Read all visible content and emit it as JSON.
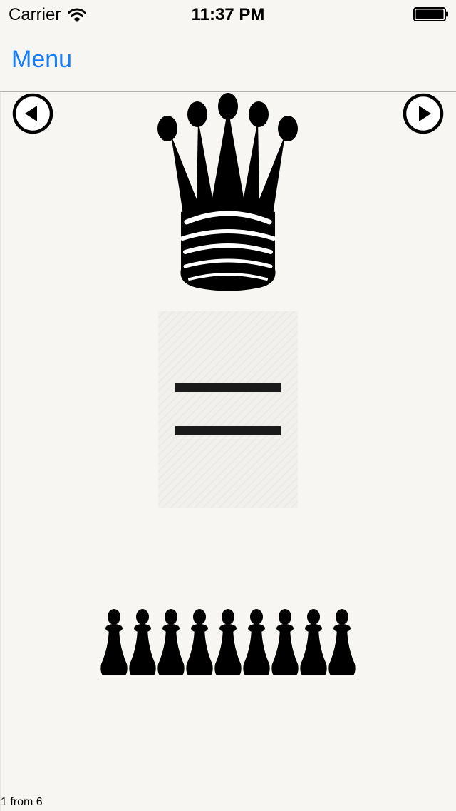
{
  "status_bar": {
    "carrier": "Carrier",
    "time": "11:37 PM",
    "wifi_icon": "wifi-icon",
    "battery_icon": "battery-full-icon"
  },
  "nav_bar": {
    "menu_label": "Menu"
  },
  "colors": {
    "accent": "#157efb",
    "background": "#f7f6f3",
    "icon": "#000000"
  },
  "main": {
    "prev_icon": "arrow-left-circle-icon",
    "next_icon": "arrow-right-circle-icon",
    "top_piece": "chess-queen-icon",
    "symbol": "equals-sign-icon",
    "bottom_piece": "chess-pawn-icon",
    "bottom_piece_count": 9
  },
  "footer": {
    "page_indicator": "1 from 6"
  }
}
